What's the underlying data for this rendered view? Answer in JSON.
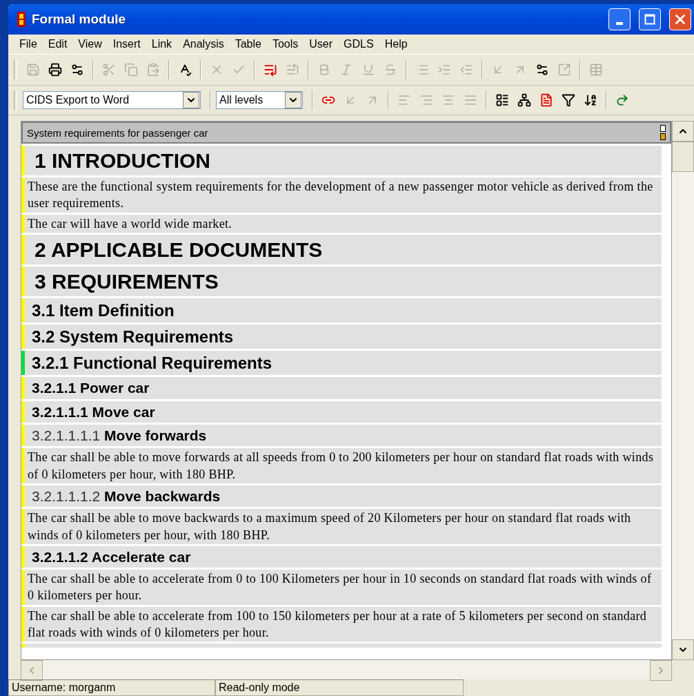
{
  "window": {
    "title": "Formal module"
  },
  "menu": [
    "File",
    "Edit",
    "View",
    "Insert",
    "Link",
    "Analysis",
    "Table",
    "Tools",
    "User",
    "GDLS",
    "Help"
  ],
  "toolbar_1": [
    {
      "kind": "save",
      "disabled": true
    },
    {
      "kind": "print",
      "disabled": false
    },
    {
      "kind": "properties",
      "disabled": false
    },
    {
      "kind": "sep"
    },
    {
      "kind": "cut",
      "disabled": true
    },
    {
      "kind": "copy",
      "disabled": true
    },
    {
      "kind": "paste",
      "disabled": true
    },
    {
      "kind": "sep"
    },
    {
      "kind": "spellcheck",
      "disabled": false
    },
    {
      "kind": "sep"
    },
    {
      "kind": "delete",
      "disabled": true
    },
    {
      "kind": "accept",
      "disabled": true
    },
    {
      "kind": "sep"
    },
    {
      "kind": "insert-below",
      "disabled": false
    },
    {
      "kind": "demote",
      "disabled": true
    },
    {
      "kind": "sep"
    },
    {
      "kind": "bold",
      "disabled": true
    },
    {
      "kind": "italic",
      "disabled": true
    },
    {
      "kind": "underline",
      "disabled": true
    },
    {
      "kind": "strike",
      "disabled": true
    },
    {
      "kind": "sep"
    },
    {
      "kind": "bullets",
      "disabled": true
    },
    {
      "kind": "indent",
      "disabled": true
    },
    {
      "kind": "outdent",
      "disabled": true
    },
    {
      "kind": "sep"
    },
    {
      "kind": "link-in",
      "disabled": true
    },
    {
      "kind": "link-out",
      "disabled": true
    },
    {
      "kind": "properties",
      "disabled": false
    },
    {
      "kind": "link-go",
      "disabled": true
    },
    {
      "kind": "sep"
    },
    {
      "kind": "table",
      "disabled": true
    }
  ],
  "view_select": {
    "value": "CIDS Export to Word"
  },
  "level_select": {
    "value": "All levels"
  },
  "toolbar_2": [
    {
      "kind": "link-make",
      "disabled": false
    },
    {
      "kind": "link-start",
      "disabled": true
    },
    {
      "kind": "link-end",
      "disabled": true
    },
    {
      "kind": "sep"
    },
    {
      "kind": "align-left",
      "disabled": true
    },
    {
      "kind": "align-right",
      "disabled": true
    },
    {
      "kind": "align-center",
      "disabled": true
    },
    {
      "kind": "align-justify",
      "disabled": true
    },
    {
      "kind": "sep"
    },
    {
      "kind": "outline",
      "disabled": false
    },
    {
      "kind": "tree",
      "disabled": false
    },
    {
      "kind": "document",
      "disabled": false
    },
    {
      "kind": "filter",
      "disabled": false
    },
    {
      "kind": "sort",
      "disabled": false
    },
    {
      "kind": "sep"
    },
    {
      "kind": "redo",
      "disabled": false
    }
  ],
  "module": {
    "title": "System requirements for passenger car"
  },
  "rows": [
    {
      "kind": "h1",
      "number": "1",
      "title": "INTRODUCTION",
      "color": "#ffff00"
    },
    {
      "kind": "text",
      "text": "These are the functional system requirements for the development of a new passenger motor vehicle as derived from the user requirements.",
      "color": "#ffff00"
    },
    {
      "kind": "text",
      "text": "The car will have a world wide market.",
      "color": "#ffff00"
    },
    {
      "kind": "h1",
      "number": "2",
      "title": "APPLICABLE DOCUMENTS",
      "color": "#ffff00"
    },
    {
      "kind": "h1",
      "number": "3",
      "title": "REQUIREMENTS",
      "color": "#ffff00"
    },
    {
      "kind": "h2",
      "number": "3.1",
      "title": "Item Definition",
      "color": "#ffff00"
    },
    {
      "kind": "h2",
      "number": "3.2",
      "title": "System Requirements",
      "color": "#ffff00"
    },
    {
      "kind": "h2",
      "number": "3.2.1",
      "title": "Functional Requirements",
      "color": "#00e040"
    },
    {
      "kind": "h3",
      "number": "3.2.1.1",
      "title": "Power car",
      "color": "#ffff00"
    },
    {
      "kind": "h3",
      "number": "3.2.1.1.1",
      "title": "Move car",
      "color": "#ffff00"
    },
    {
      "kind": "h4",
      "number": "3.2.1.1.1.1",
      "title": "Move forwards",
      "color": "#ffff00"
    },
    {
      "kind": "text",
      "text": "The car shall be able to move forwards at all speeds from 0 to 200 kilometers per hour on standard flat roads with winds of 0 kilometers per hour, with 180 BHP.",
      "color": "#ffff00"
    },
    {
      "kind": "h4",
      "number": "3.2.1.1.1.2",
      "title": "Move backwards",
      "color": "#ffff00"
    },
    {
      "kind": "text",
      "text": "The car shall be able to move backwards to a maximum speed of 20 Kilometers per hour on standard flat roads with winds of 0 kilometers per hour, with 180 BHP.",
      "color": "#ffff00"
    },
    {
      "kind": "h3",
      "number": "3.2.1.1.2",
      "title": "Accelerate car",
      "color": "#ffff00"
    },
    {
      "kind": "text",
      "text": "The car shall be able to accelerate from 0 to 100 Kilometers per hour in 10 seconds on standard flat roads with winds of 0 kilometers per hour.",
      "color": "#ffff00"
    },
    {
      "kind": "text",
      "text": "The car shall be able to accelerate from 100 to 150 kilometers per hour at a rate of 5 kilometers per second on standard flat roads with winds of 0 kilometers per hour.",
      "color": "#ffff00"
    }
  ],
  "status_bar": {
    "user": "Username: morganm",
    "mode": "Read-only mode"
  }
}
